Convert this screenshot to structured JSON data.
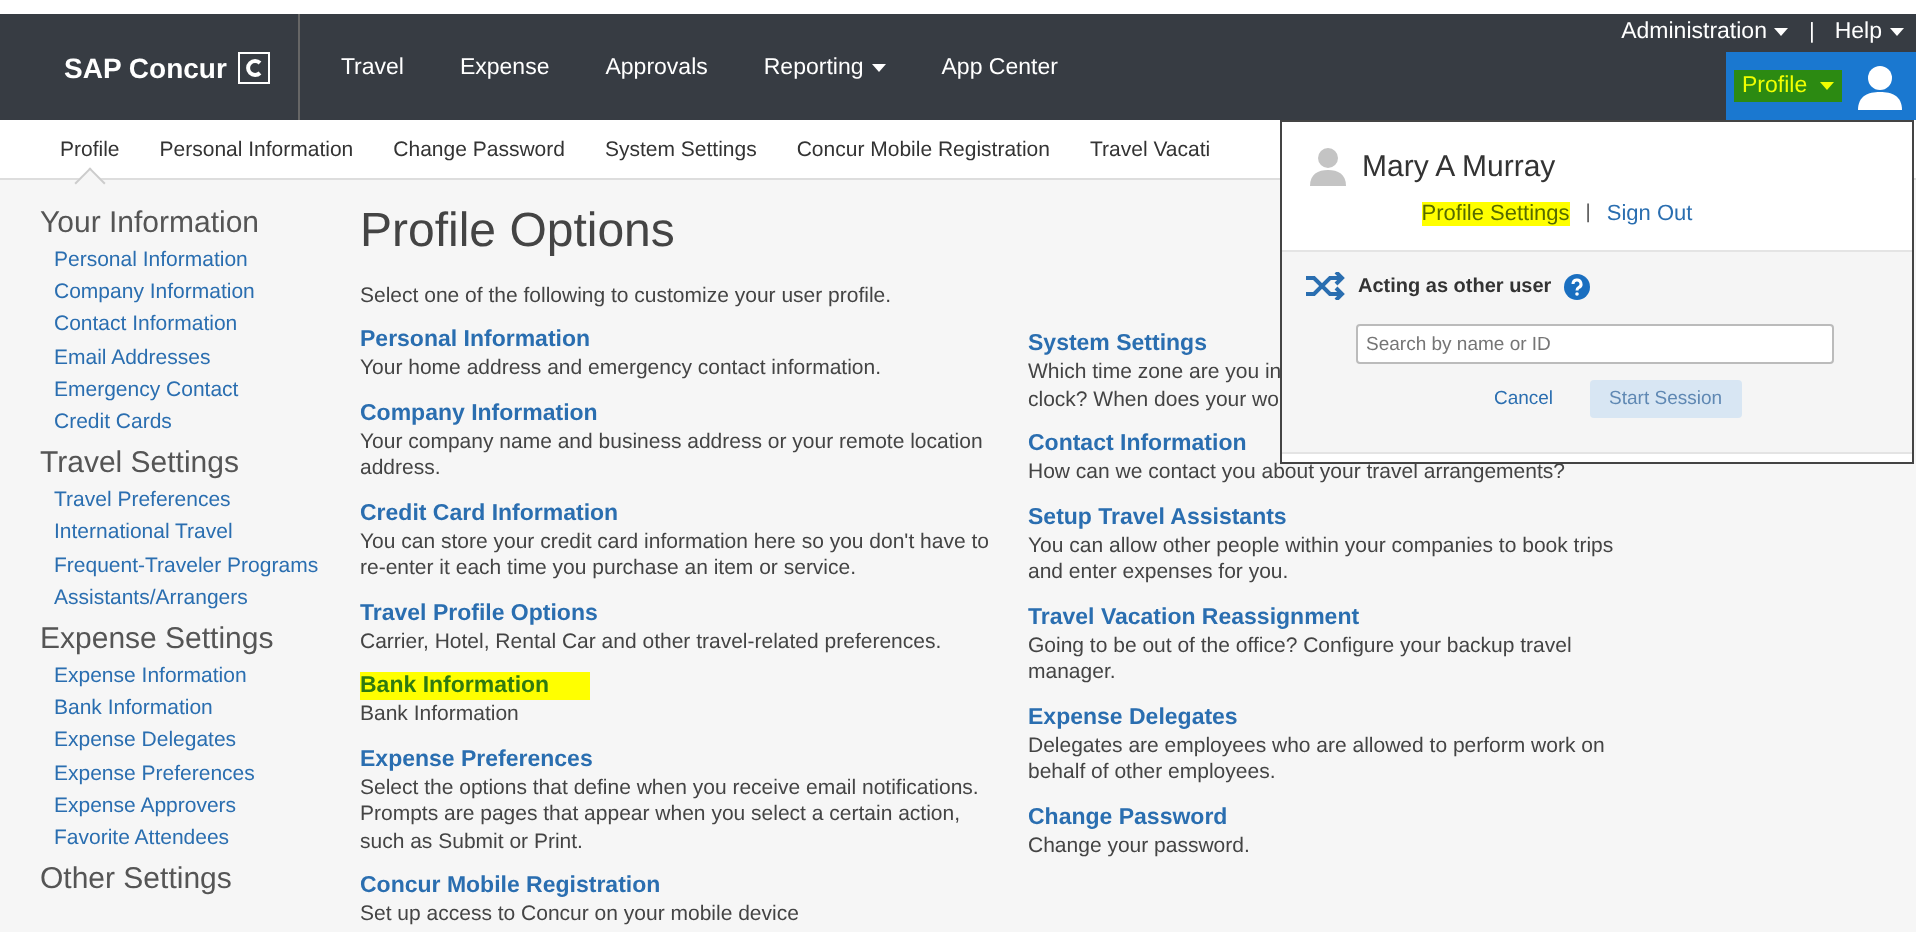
{
  "header": {
    "logo": "SAP Concur",
    "nav": [
      {
        "label": "Travel",
        "dropdown": false
      },
      {
        "label": "Expense",
        "dropdown": false
      },
      {
        "label": "Approvals",
        "dropdown": false
      },
      {
        "label": "Reporting",
        "dropdown": true
      },
      {
        "label": "App Center",
        "dropdown": false
      }
    ],
    "utility_links": [
      {
        "label": "Administration"
      },
      {
        "label": "Help"
      }
    ],
    "utility_separator": "|",
    "profile_button": {
      "label": "Profile",
      "highlighted": true
    }
  },
  "tabs": [
    {
      "label": "Profile",
      "selected": true
    },
    {
      "label": "Personal Information",
      "selected": false
    },
    {
      "label": "Change Password",
      "selected": false
    },
    {
      "label": "System Settings",
      "selected": false
    },
    {
      "label": "Concur Mobile Registration",
      "selected": false
    },
    {
      "label": "Travel Vacati",
      "selected": false
    }
  ],
  "sidebar": [
    {
      "title": "Your Information",
      "items": [
        "Personal Information",
        "Company Information",
        "Contact Information",
        "Email Addresses",
        "Emergency Contact",
        "Credit Cards"
      ]
    },
    {
      "title": "Travel Settings",
      "items": [
        "Travel Preferences",
        "International Travel",
        "Frequent-Traveler Programs",
        "Assistants/Arrangers"
      ]
    },
    {
      "title": "Expense Settings",
      "items": [
        "Expense Information",
        "Bank Information",
        "Expense Delegates",
        "Expense Preferences",
        "Expense Approvers",
        "Favorite Attendees"
      ]
    },
    {
      "title": "Other Settings"
    }
  ],
  "main": {
    "title": "Profile Options",
    "intro": "Select one of the following to customize your user profile.",
    "columns": [
      [
        {
          "title": "Personal Information",
          "description": "Your home address and emergency contact information.",
          "highlighted": false
        },
        {
          "title": "Company Information",
          "description": "Your company name and business address or your remote location address.",
          "highlighted": false
        },
        {
          "title": "Credit Card Information",
          "description": "You can store your credit card information here so you don't have to re-enter it each time you purchase an item or service.",
          "highlighted": false
        },
        {
          "title": "Travel Profile Options",
          "description": "Carrier, Hotel, Rental Car and other travel-related preferences.",
          "highlighted": false
        },
        {
          "title": "Bank Information",
          "description": "Bank Information",
          "highlighted": true
        },
        {
          "title": "Expense Preferences",
          "description": "Select the options that define when you receive email notifications. Prompts are pages that appear when you select a certain action, such as Submit or Print.",
          "highlighted": false
        },
        {
          "title": "Concur Mobile Registration",
          "description": "Set up access to Concur on your mobile device",
          "highlighted": false
        }
      ],
      [
        {
          "title": "System Settings",
          "description": "Which time zone are you in\nclock? When does your wo",
          "highlighted": false
        },
        {
          "title": "Contact Information",
          "description": "How can we contact you about your travel arrangements?",
          "highlighted": false
        },
        {
          "title": "Setup Travel Assistants",
          "description": "You can allow other people within your companies to book trips and enter expenses for you.",
          "highlighted": false
        },
        {
          "title": "Travel Vacation Reassignment",
          "description": "Going to be out of the office? Configure your backup travel manager.",
          "highlighted": false
        },
        {
          "title": "Expense Delegates",
          "description": "Delegates are employees who are allowed to perform work on behalf of other employees.",
          "highlighted": false
        },
        {
          "title": "Change Password",
          "description": "Change your password.",
          "highlighted": false
        }
      ]
    ]
  },
  "popup": {
    "user_name": "Mary A Murray",
    "link_separator": "|",
    "links": [
      {
        "label": "Profile Settings",
        "highlighted": true
      },
      {
        "label": "Sign Out",
        "highlighted": false
      }
    ],
    "acting": {
      "title": "Acting as other user",
      "placeholder": "Search by name or ID",
      "cancel": "Cancel",
      "start": {
        "label": "Start Session",
        "disabled": true
      }
    }
  }
}
